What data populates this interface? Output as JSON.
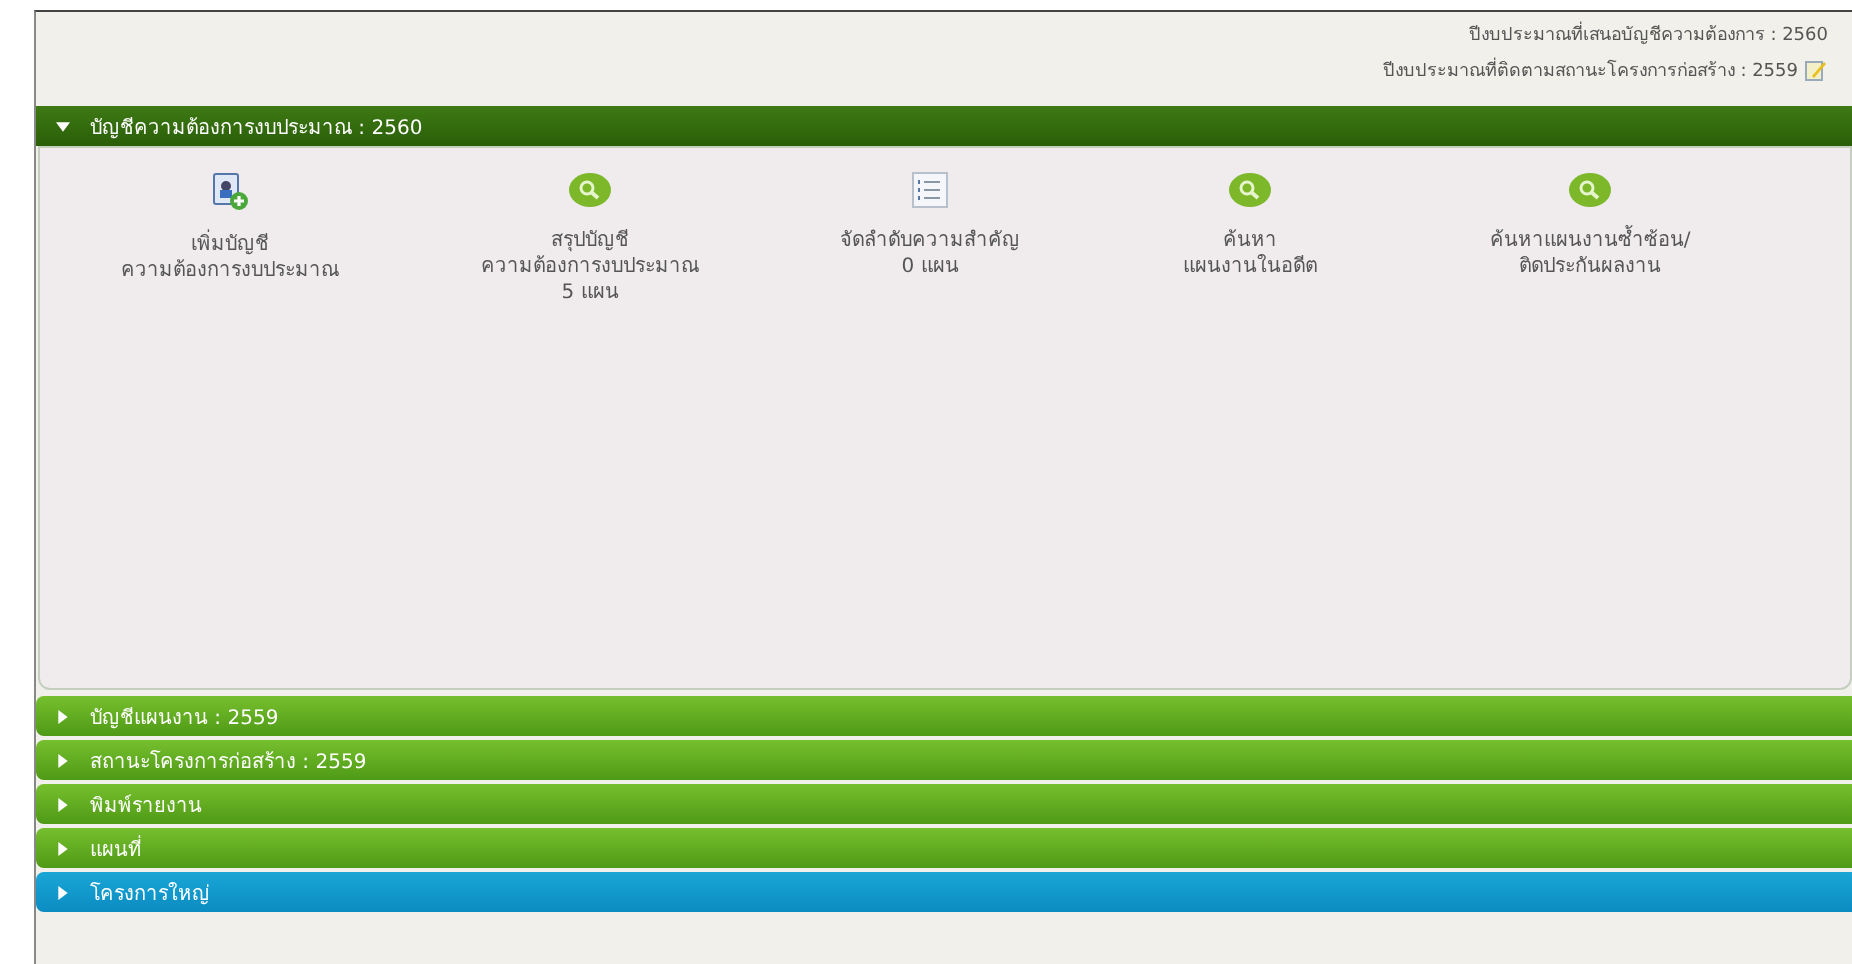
{
  "info_lines": [
    {
      "label": "ปีงบประมาณที่เสนอบัญชีความต้องการ : 2560",
      "editable": false
    },
    {
      "label": "ปีงบประมาณที่ติดตามสถานะโครงการก่อสร้าง : 2559",
      "editable": true
    }
  ],
  "sections": [
    {
      "label": "บัญชีความต้องการงบประมาณ : 2560",
      "expanded": true,
      "selected": false,
      "tools": [
        {
          "kind": "add",
          "lines": [
            "เพิ่มบัญชี",
            "ความต้องการงบประมาณ"
          ]
        },
        {
          "kind": "search",
          "lines": [
            "สรุปบัญชี",
            "ความต้องการงบประมาณ",
            "5 แผน"
          ]
        },
        {
          "kind": "list",
          "lines": [
            "จัดลำดับความสำคัญ",
            "0 แผน"
          ]
        },
        {
          "kind": "search",
          "lines": [
            "ค้นหา",
            "แผนงานในอดีต"
          ]
        },
        {
          "kind": "search",
          "lines": [
            "ค้นหาแผนงานซ้ำซ้อน/",
            "ติดประกันผลงาน"
          ]
        }
      ]
    },
    {
      "label": "บัญชีแผนงาน : 2559",
      "expanded": false,
      "selected": false
    },
    {
      "label": "สถานะโครงการก่อสร้าง : 2559",
      "expanded": false,
      "selected": false
    },
    {
      "label": "พิมพ์รายงาน",
      "expanded": false,
      "selected": false
    },
    {
      "label": "แผนที่",
      "expanded": false,
      "selected": false
    },
    {
      "label": "โครงการใหญ่",
      "expanded": false,
      "selected": true
    }
  ]
}
